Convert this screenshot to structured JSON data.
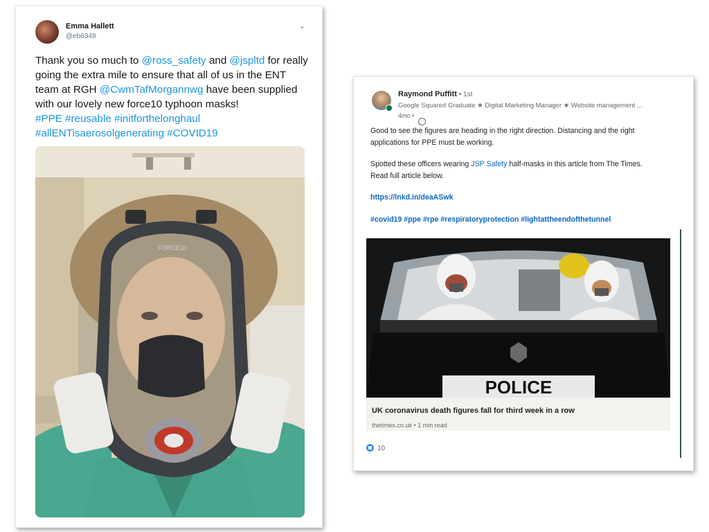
{
  "tweet": {
    "name": "Emma Hallett",
    "handle": "@eb6348",
    "text_1": "Thank you so much to ",
    "mention_1": "@ross_safety",
    "text_2": " and ",
    "mention_2": "@jspltd",
    "text_3": " for really going the extra mile to ensure that all of us in the ENT team at RGH ",
    "mention_3": "@CwmTafMorgannwg",
    "text_4": "  have been supplied with our lovely new force10 typhoon masks!",
    "hashtags_line1": "#PPE #reusable #initforthelonghaul",
    "hashtags_line2": "#allENTisaerosolgenerating #COVID19",
    "mask_brand": "FORCE10"
  },
  "linkedin": {
    "name": "Raymond Puffitt",
    "degree": " • 1st",
    "headline": "Google Squared Graduate ★ Digital Marketing Manager ★ Website management ...",
    "time": "4mo •",
    "para1": "Good to see the figures are heading in the right direction. Distancing and the right applications for PPE must be working.",
    "para2_a": "Spotted these officers wearing ",
    "para2_link": "JSP Safety",
    "para2_b": " half-masks in this article from The Times. Read full article below.",
    "url": "https://lnkd.in/deaASwk",
    "hashtags": "#covid19 #ppe #rpe #respiratoryprotection #lightattheendofthetunnel",
    "police_sign": "POLICE",
    "article_title": "UK coronavirus death figures fall for third week in a row",
    "article_source": "thetimes.co.uk • 1 min read",
    "reactions": "10"
  }
}
